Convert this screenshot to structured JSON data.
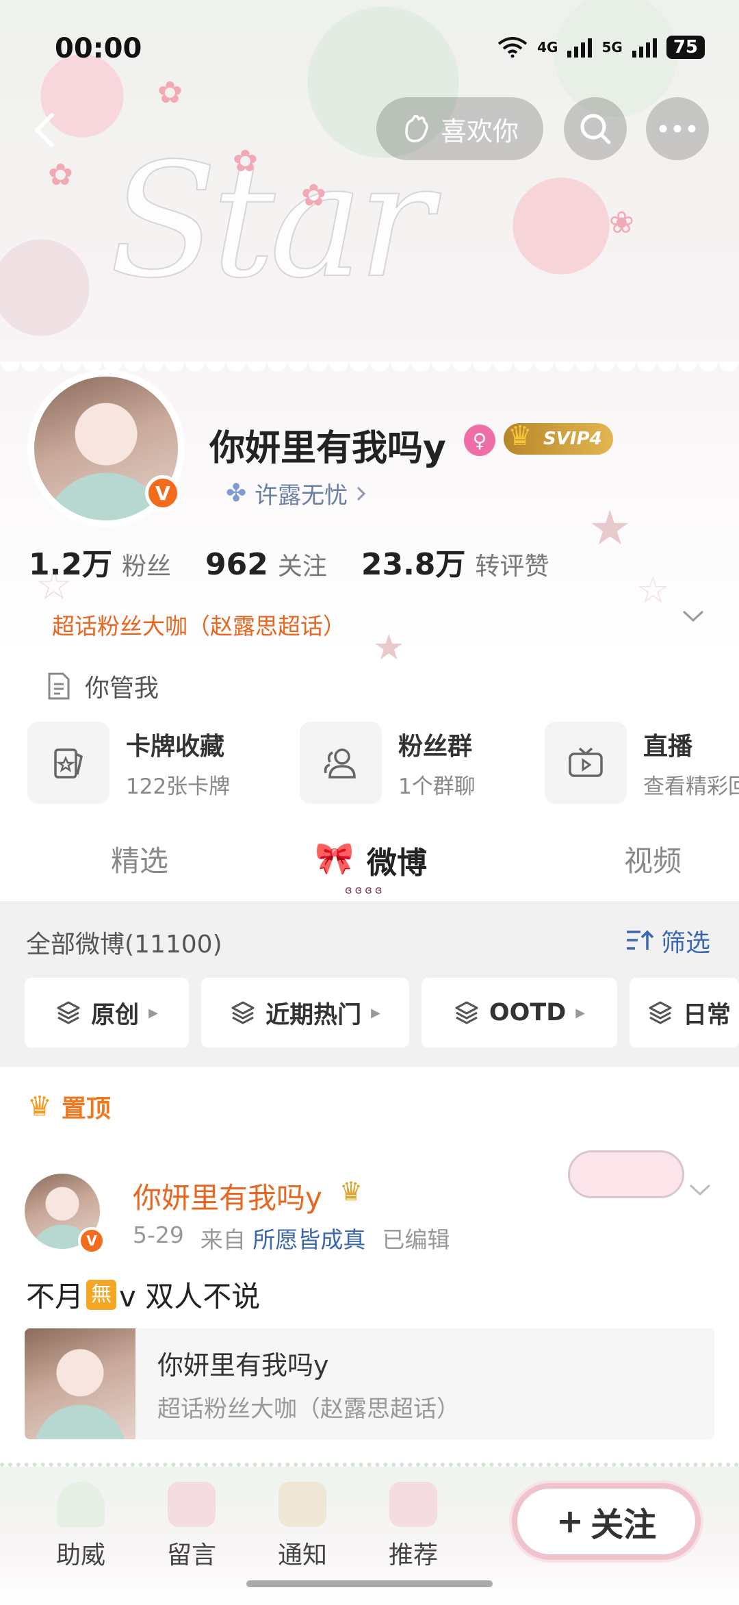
{
  "status_bar": {
    "time": "00:00",
    "network_1": "4G",
    "network_2": "5G",
    "battery": "75"
  },
  "nav": {
    "like_label": "喜欢你"
  },
  "profile": {
    "username": "你妍里有我吗y",
    "svip_label": "SVIP4",
    "supertag": "许露无忧",
    "stats": [
      {
        "num": "1.2万",
        "label": "粉丝"
      },
      {
        "num": "962",
        "label": "关注"
      },
      {
        "num": "23.8万",
        "label": "转评赞"
      }
    ],
    "fan_title": "超话粉丝大咖（赵露思超话）",
    "intro": "你管我"
  },
  "features": [
    {
      "title": "卡牌收藏",
      "subtitle": "122张卡牌",
      "icon": "card-icon"
    },
    {
      "title": "粉丝群",
      "subtitle": "1个群聊",
      "icon": "group-icon"
    },
    {
      "title": "直播",
      "subtitle": "查看精彩回",
      "icon": "tv-icon"
    }
  ],
  "tabs": [
    {
      "label": "精选"
    },
    {
      "label": "微博"
    },
    {
      "label": "视频"
    }
  ],
  "feed": {
    "all_label": "全部微博(11100)",
    "filter_label": "筛选",
    "chips": [
      {
        "label": "原创"
      },
      {
        "label": "近期热门"
      },
      {
        "label": "OOTD"
      },
      {
        "label": "日常"
      }
    ]
  },
  "pinned": {
    "pin_label": "置顶",
    "name": "你妍里有我吗y",
    "date": "5-29",
    "from": "来自",
    "source": "所愿皆成真",
    "edited": "已编辑",
    "text_a": "不月",
    "emoji": "無",
    "text_b": "v  双人不说",
    "share_title": "你妍里有我吗y",
    "share_sub": "超话粉丝大咖（赵露思超话）"
  },
  "bottom": {
    "items": [
      {
        "label": "助威"
      },
      {
        "label": "留言"
      },
      {
        "label": "通知"
      },
      {
        "label": "推荐"
      }
    ],
    "follow_label": "关注"
  },
  "colors": {
    "accent_orange": "#e8661f",
    "link_blue": "#3b67b1",
    "vip_gold": "#e2b650"
  }
}
